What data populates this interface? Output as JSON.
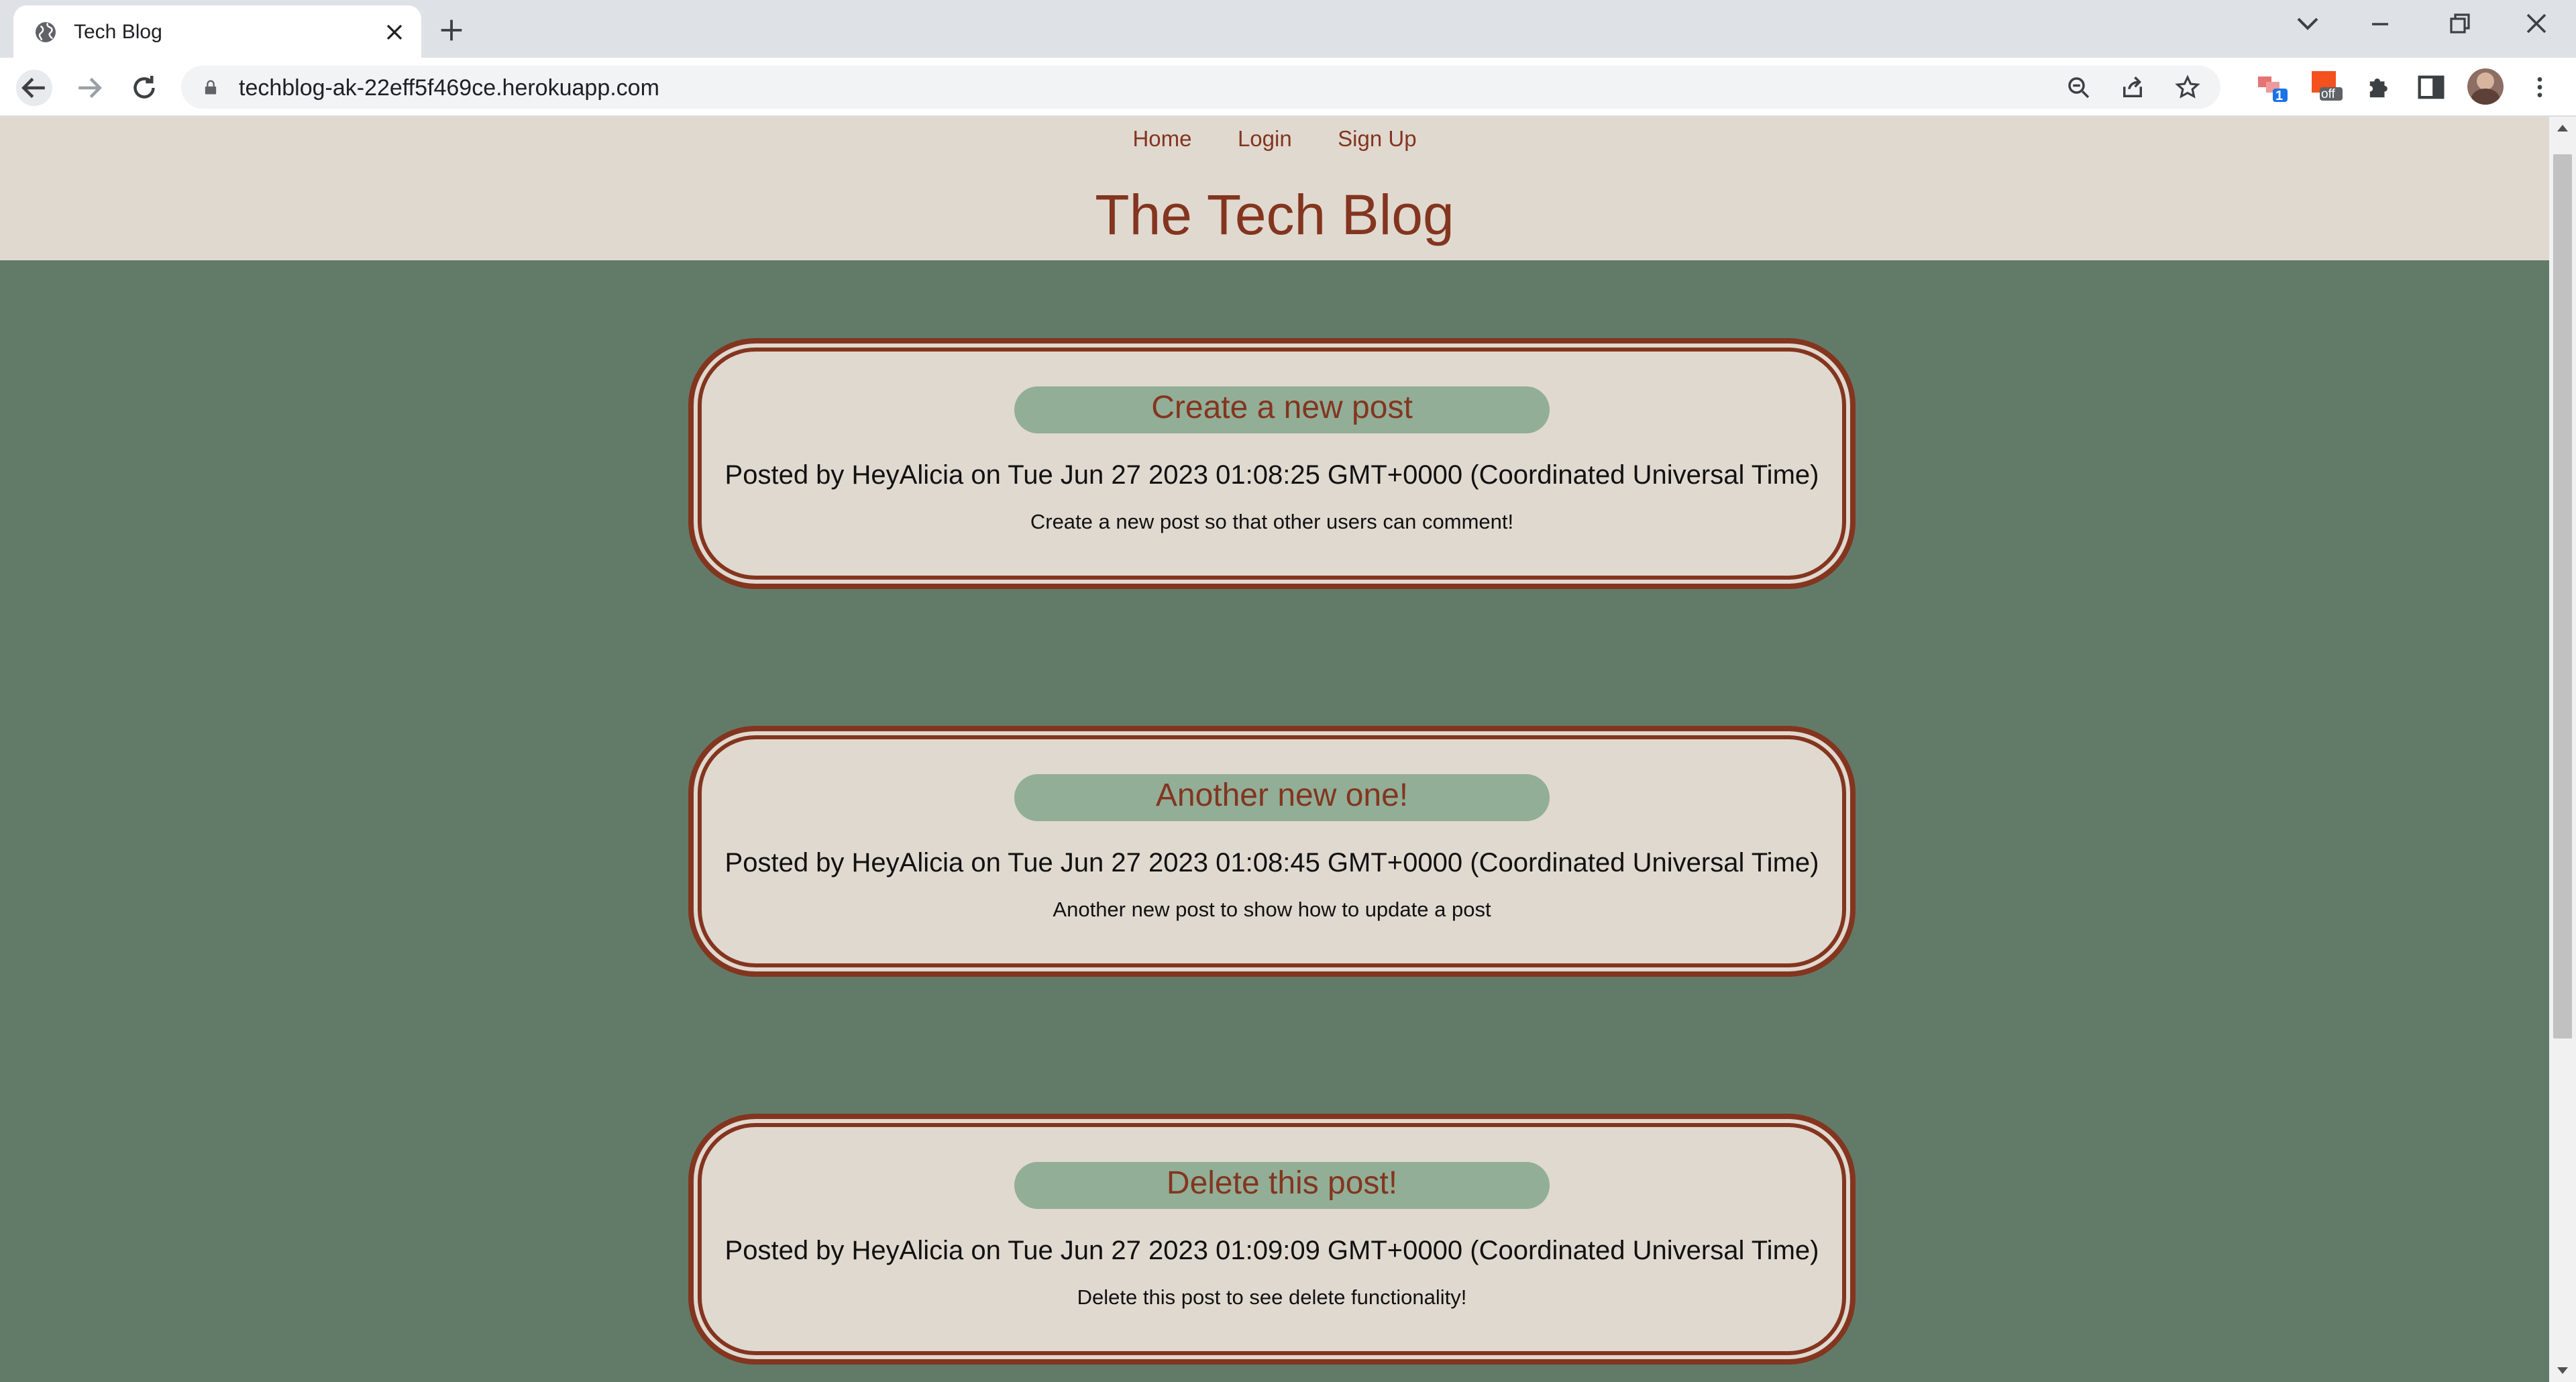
{
  "browser": {
    "tab_title": "Tech Blog",
    "url": "techblog-ak-22eff5f469ce.herokuapp.com",
    "extension_badge_count": "1",
    "extension_off_label": "off"
  },
  "site": {
    "nav": [
      {
        "label": "Home"
      },
      {
        "label": "Login"
      },
      {
        "label": "Sign Up"
      }
    ],
    "title": "The Tech Blog"
  },
  "posts": [
    {
      "title": "Create a new post",
      "meta": "Posted by HeyAlicia on Tue Jun 27 2023 01:08:25 GMT+0000 (Coordinated Universal Time)",
      "body": "Create a new post so that other users can comment!"
    },
    {
      "title": "Another new one!",
      "meta": "Posted by HeyAlicia on Tue Jun 27 2023 01:08:45 GMT+0000 (Coordinated Universal Time)",
      "body": "Another new post to show how to update a post"
    },
    {
      "title": "Delete this post!",
      "meta": "Posted by HeyAlicia on Tue Jun 27 2023 01:09:09 GMT+0000 (Coordinated Universal Time)",
      "body": "Delete this post to see delete functionality!"
    }
  ],
  "colors": {
    "header_bg": "#e0d9d0",
    "page_bg": "#627b69",
    "accent": "#83351f",
    "title_pill": "#92ae97"
  },
  "icons": {
    "tab_favicon": "globe-icon",
    "zoom": "zoom-out-icon",
    "share": "share-icon",
    "bookmark": "star-icon",
    "extensions": "puzzle-icon",
    "side_panel": "side-panel-icon",
    "menu": "kebab-menu-icon"
  }
}
